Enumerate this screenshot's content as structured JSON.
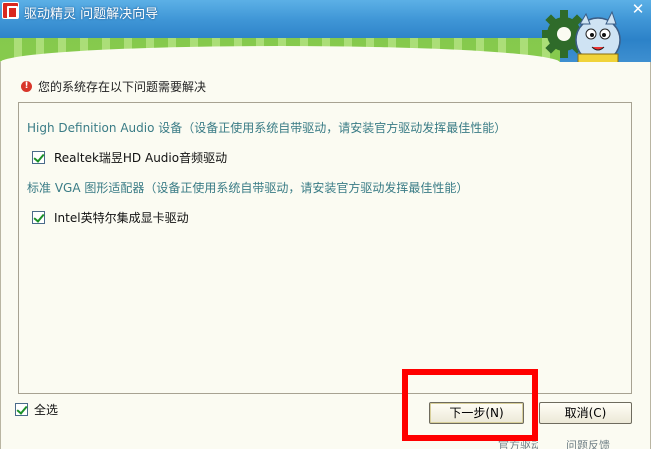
{
  "window": {
    "title": "驱动精灵 问题解决向导",
    "close_symbol": "✕"
  },
  "notice": {
    "icon": "info-icon",
    "text": "您的系统存在以下问题需要解决"
  },
  "issues": [
    {
      "category": "High Definition Audio 设备（设备正使用系统自带驱动，请安装官方驱动发挥最佳性能）",
      "item_label": "Realtek瑞昱HD Audio音频驱动",
      "checked": true
    },
    {
      "category": "标准 VGA 图形适配器（设备正使用系统自带驱动，请安装官方驱动发挥最佳性能）",
      "item_label": "Intel英特尔集成显卡驱动",
      "checked": true
    }
  ],
  "footer": {
    "select_all_label": "全选",
    "select_all_checked": true,
    "next_label": "下一步(N)",
    "cancel_label": "取消(C)",
    "obscured_text_1": "官方驱动",
    "obscured_text_2": "问题反馈"
  },
  "colors": {
    "titlebar": "#2c82c8",
    "content_bg": "#fbfbf2",
    "category_text": "#3a7c86",
    "check": "#1c9128",
    "highlight": "#ff0000"
  }
}
